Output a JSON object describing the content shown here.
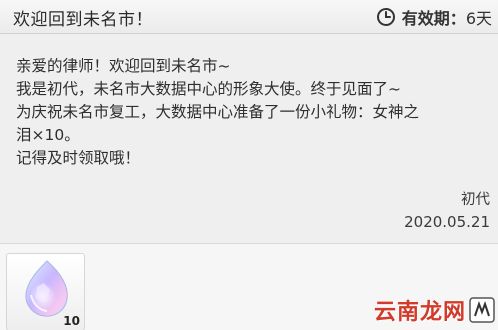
{
  "mail": {
    "title": "欢迎回到未名市！",
    "expiry_label": "有效期：",
    "expiry_value": "6天",
    "body_lines": [
      "亲爱的律师！欢迎回到未名市~",
      "我是初代，未名市大数据中心的形象大使。终于见面了~",
      "为庆祝未名市复工，大数据中心准备了一份小礼物：女神之",
      "泪×10。",
      "记得及时领取哦！"
    ],
    "sender": "初代",
    "date": "2020.05.21"
  },
  "attachment": {
    "count": "10",
    "icon": "tear-crystal-icon"
  },
  "watermark": {
    "text": "云南龙网"
  },
  "colors": {
    "header_bg": "#efefef",
    "body_bg": "#efefef",
    "watermark": "#d23a2a"
  }
}
